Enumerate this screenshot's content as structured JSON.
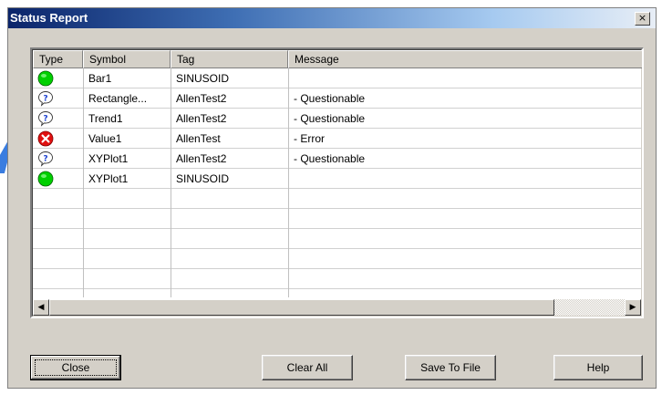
{
  "window": {
    "title": "Status Report",
    "close_glyph": "×"
  },
  "table": {
    "columns": [
      "Type",
      "Symbol",
      "Tag",
      "Message"
    ],
    "rows": [
      {
        "type": "ok",
        "symbol": "Bar1",
        "tag": "SINUSOID",
        "message": ""
      },
      {
        "type": "questionable",
        "symbol": "Rectangle...",
        "tag": "AllenTest2",
        "message": " - Questionable"
      },
      {
        "type": "questionable",
        "symbol": "Trend1",
        "tag": "AllenTest2",
        "message": " - Questionable"
      },
      {
        "type": "error",
        "symbol": "Value1",
        "tag": "AllenTest",
        "message": " - Error"
      },
      {
        "type": "questionable",
        "symbol": "XYPlot1",
        "tag": "AllenTest2",
        "message": " - Questionable"
      },
      {
        "type": "ok",
        "symbol": "XYPlot1",
        "tag": "SINUSOID",
        "message": ""
      }
    ],
    "icons": {
      "ok": "green-circle-icon",
      "questionable": "question-bubble-icon",
      "error": "red-x-circle-icon"
    }
  },
  "buttons": {
    "close": "Close",
    "clear_all": "Clear All",
    "save_to_file": "Save To File",
    "help": "Help"
  },
  "colors": {
    "ok": "#00d000",
    "error": "#e01010",
    "title_bar": "#0a246a"
  }
}
